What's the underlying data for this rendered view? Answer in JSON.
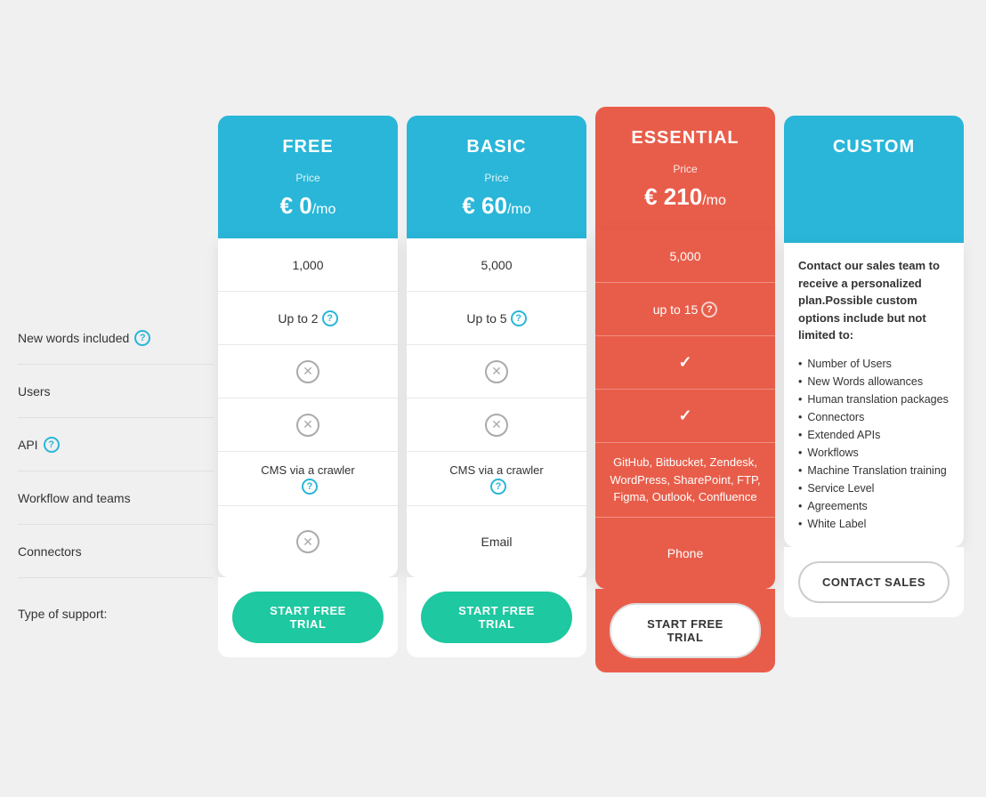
{
  "page": {
    "background": "#f0f0f0"
  },
  "features": {
    "labels": [
      {
        "id": "new-words",
        "text": "New words included",
        "hasTooltip": true
      },
      {
        "id": "users",
        "text": "Users",
        "hasTooltip": false
      },
      {
        "id": "api",
        "text": "API",
        "hasTooltip": true
      },
      {
        "id": "workflow",
        "text": "Workflow and teams",
        "hasTooltip": false
      },
      {
        "id": "connectors",
        "text": "Connectors",
        "hasTooltip": false
      },
      {
        "id": "support",
        "text": "Type of support:",
        "hasTooltip": false
      }
    ]
  },
  "plans": {
    "free": {
      "name": "FREE",
      "priceLabel": "Price",
      "price": "€ 0",
      "priceSuffix": "/mo",
      "headerColor": "blue",
      "newWords": "1,000",
      "users": "Up to 2",
      "usersTooltip": true,
      "api": "x",
      "workflow": "x",
      "connectors": "CMS via a crawler",
      "connectorsTooltip": true,
      "support": "x",
      "cta": "START FREE TRIAL",
      "ctaStyle": "green"
    },
    "basic": {
      "name": "BASIC",
      "priceLabel": "Price",
      "price": "€ 60",
      "priceSuffix": "/mo",
      "headerColor": "blue",
      "newWords": "5,000",
      "users": "Up to 5",
      "usersTooltip": true,
      "api": "x",
      "workflow": "x",
      "connectors": "CMS via a crawler",
      "connectorsTooltip": true,
      "support": "Email",
      "cta": "START FREE TRIAL",
      "ctaStyle": "green"
    },
    "essential": {
      "name": "ESSENTIAL",
      "priceLabel": "Price",
      "price": "€ 210",
      "priceSuffix": "/mo",
      "headerColor": "red",
      "newWords": "5,000",
      "users": "up to 15",
      "usersTooltip": true,
      "api": "check",
      "workflow": "check",
      "connectors": "GitHub, Bitbucket, Zendesk, WordPress, SharePoint, FTP, Figma, Outlook, Confluence",
      "support": "Phone",
      "cta": "START FREE TRIAL",
      "ctaStyle": "white"
    },
    "custom": {
      "name": "CUSTOM",
      "headerColor": "teal",
      "description": "Contact our sales team to receive a personalized plan.Possible custom options include but not limited to:",
      "listItems": [
        "Number of Users",
        "New Words allowances",
        "Human translation packages",
        "Connectors",
        "Extended APIs",
        "Workflows",
        "Machine Translation training",
        "Service Level",
        "Agreements",
        "White Label"
      ],
      "cta": "CONTACT SALES",
      "ctaStyle": "outline"
    }
  },
  "icons": {
    "question": "?",
    "x": "✕",
    "check": "✓"
  }
}
